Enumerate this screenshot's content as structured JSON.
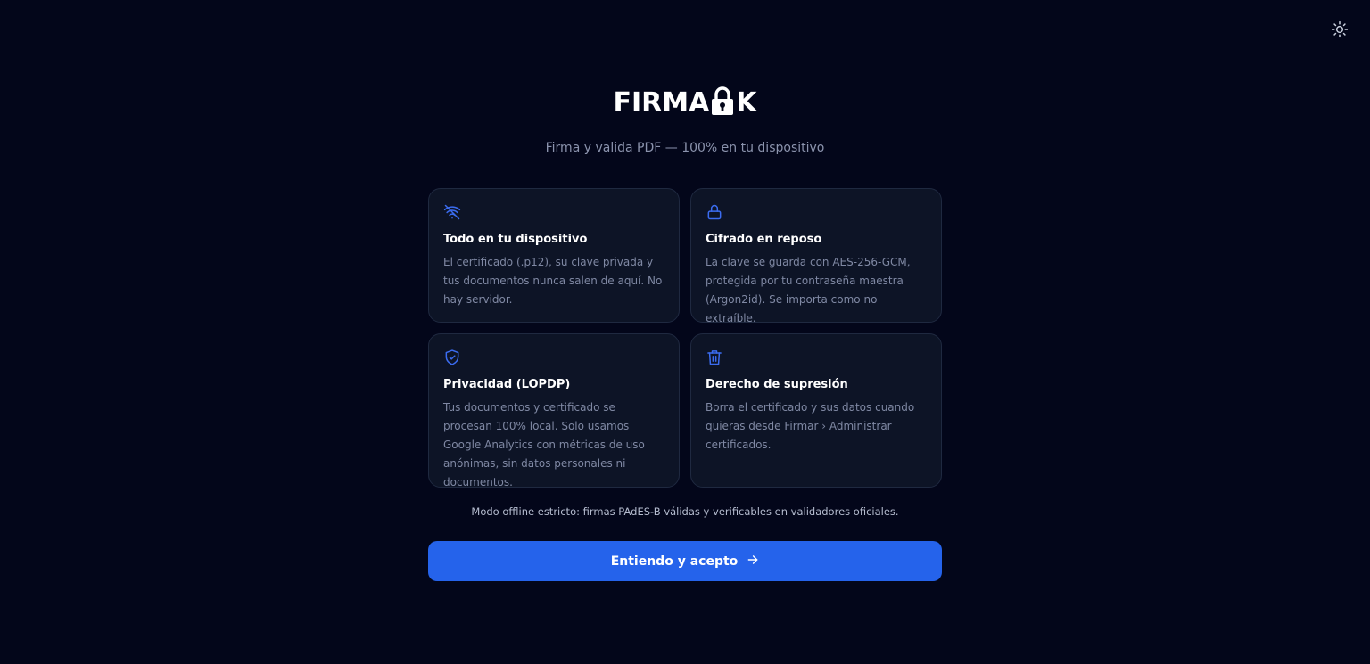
{
  "header": {
    "theme_toggle_icon": "sun-icon"
  },
  "brand": {
    "logo_text_left": "FIRMA",
    "logo_text_right": "K",
    "logo_icon": "padlock-icon",
    "tagline": "Firma y valida PDF — 100% en tu dispositivo"
  },
  "features": [
    {
      "icon": "wifi-off-icon",
      "title": "Todo en tu dispositivo",
      "text": "El certificado (.p12), su clave privada y tus documentos nunca salen de aquí. No hay servidor."
    },
    {
      "icon": "lock-icon",
      "title": "Cifrado en reposo",
      "text": "La clave se guarda con AES-256-GCM, protegida por tu contraseña maestra (Argon2id). Se importa como no extraíble."
    },
    {
      "icon": "shield-check-icon",
      "title": "Privacidad (LOPDP)",
      "text": "Tus documentos y certificado se procesan 100% local. Solo usamos Google Analytics con métricas de uso anónimas, sin datos personales ni documentos."
    },
    {
      "icon": "trash-icon",
      "title": "Derecho de supresión",
      "text": "Borra el certificado y sus datos cuando quieras desde Firmar › Administrar certificados."
    }
  ],
  "note": "Modo offline estricto: firmas PAdES-B válidas y verificables en validadores oficiales.",
  "accept_button": {
    "label": "Entiendo y acepto",
    "icon": "arrow-right-icon"
  },
  "colors": {
    "background": "#03061a",
    "card": "#0d1426",
    "accent": "#2563eb",
    "icon_blue": "#3b6cf0"
  }
}
